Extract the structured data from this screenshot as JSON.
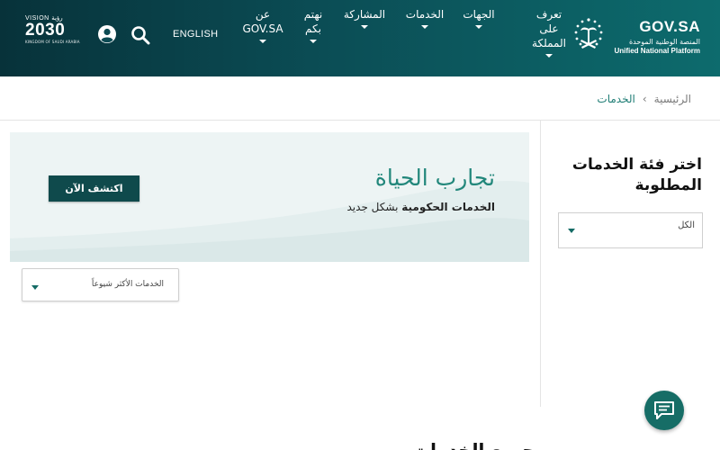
{
  "header": {
    "logo": {
      "title": "GOV.SA",
      "subtitle_ar": "المنصة الوطنية الموحدة",
      "subtitle_en": "Unified National Platform"
    },
    "nav": [
      {
        "label": "تعرف على المملكة"
      },
      {
        "label": "الجهات"
      },
      {
        "label": "الخدمات"
      },
      {
        "label": "المشاركة"
      },
      {
        "label": "نهتم بكم"
      },
      {
        "label": "عن GOV.SA"
      }
    ],
    "language_label": "ENGLISH",
    "vision": {
      "line1": "VISION رؤية",
      "year": "2030",
      "line3": "KINGDOM OF SAUDI ARABIA"
    },
    "icons": {
      "search": "search-icon",
      "user": "user-icon"
    }
  },
  "breadcrumb": {
    "home": "الرئيسية",
    "current": "الخدمات",
    "separator": "›"
  },
  "sidebar": {
    "title": "اختر فئة الخدمات المطلوبة",
    "category_select": {
      "value": "الكل"
    }
  },
  "banner": {
    "title": "تجارب الحياة",
    "subtitle_bold": "الخدمات الحكومية",
    "subtitle_rest": " بشكل جديد",
    "cta": "اكتشف الآن"
  },
  "sort_select": {
    "value": "الخدمات الأكثر شيوعاً"
  },
  "main": {
    "all_services_heading": "جميع الخدمات"
  },
  "colors": {
    "header_dark": "#07323a",
    "header_light": "#0d6b6d",
    "accent": "#22877b",
    "button": "#0f4a4c",
    "chat": "#166d66"
  }
}
